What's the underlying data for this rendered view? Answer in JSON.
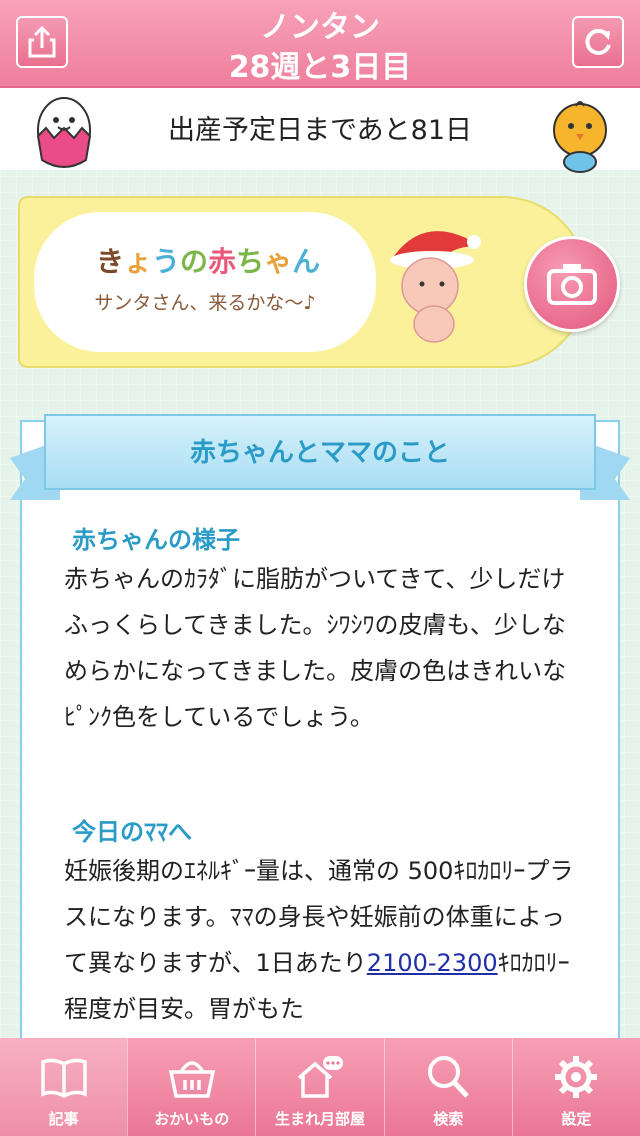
{
  "header": {
    "title": "ノンタン",
    "subtitle": "28週と3日目",
    "share_icon": "share-icon",
    "refresh_icon": "refresh-icon"
  },
  "countdown": {
    "text": "出産予定日まであと81日"
  },
  "banner": {
    "title_chars": [
      "き",
      "ょ",
      "う",
      "の",
      "赤",
      "ち",
      "ゃ",
      "ん"
    ],
    "title_colors": [
      "#7a4a2a",
      "#e9a23b",
      "#4bb0d6",
      "#7ab648",
      "#e85a7a",
      "#7ab648",
      "#e9a23b",
      "#4bb0d6"
    ],
    "message": "サンタさん、来るかな〜♪",
    "camera_icon": "camera-icon"
  },
  "section_header": "赤ちゃんとママのこと",
  "sections": [
    {
      "title": "赤ちゃんの様子",
      "body": "赤ちゃんのｶﾗﾀﾞに脂肪がついてきて、少しだけふっくらしてきました。ｼﾜｼﾜの皮膚も、少しなめらかになってきました。皮膚の色はきれいなﾋﾟﾝｸ色をしているでしょう。"
    },
    {
      "title": "今日のﾏﾏへ",
      "body_part1": "妊娠後期のｴﾈﾙｷﾞｰ量は、通常の 500ｷﾛｶﾛﾘｰプラスになります。ﾏﾏの身長や妊娠前の体重によって異なりますが、1日あたり",
      "body_link": "2100-2300",
      "body_part2": "ｷﾛｶﾛﾘｰ程度が目安。胃がもた"
    }
  ],
  "tabs": [
    {
      "label": "記事",
      "icon": "book-icon"
    },
    {
      "label": "おかいもの",
      "icon": "basket-icon"
    },
    {
      "label": "生まれ月部屋",
      "icon": "house-chat-icon"
    },
    {
      "label": "検索",
      "icon": "search-icon"
    },
    {
      "label": "設定",
      "icon": "gear-icon"
    }
  ],
  "colors": {
    "header_pink": "#ef7f9d",
    "accent_blue": "#2a9bc6",
    "banner_yellow": "#fbf19a"
  }
}
